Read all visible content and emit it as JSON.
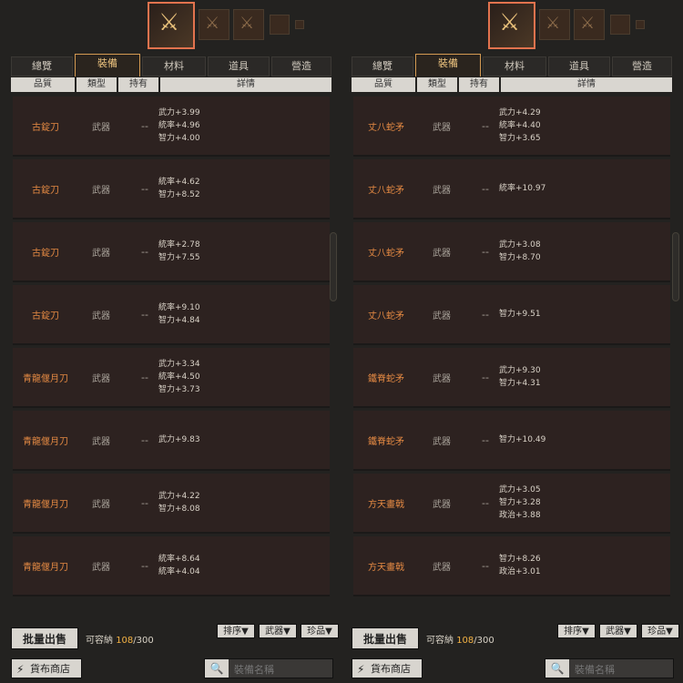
{
  "panels": [
    {
      "tabs": [
        {
          "label": "總覽",
          "active": false
        },
        {
          "label": "裝備",
          "active": true
        },
        {
          "label": "材料",
          "active": false
        },
        {
          "label": "道具",
          "active": false
        },
        {
          "label": "營造",
          "active": false
        }
      ],
      "columns": [
        "品質",
        "類型",
        "持有",
        "詳情"
      ],
      "rows": [
        {
          "name": "古錠刀",
          "type": "武器",
          "owned": "--",
          "details": [
            "武力+3.99",
            "統率+4.96",
            "智力+4.00"
          ]
        },
        {
          "name": "古錠刀",
          "type": "武器",
          "owned": "--",
          "details": [
            "統率+4.62",
            "智力+8.52"
          ]
        },
        {
          "name": "古錠刀",
          "type": "武器",
          "owned": "--",
          "details": [
            "統率+2.78",
            "智力+7.55"
          ]
        },
        {
          "name": "古錠刀",
          "type": "武器",
          "owned": "--",
          "details": [
            "統率+9.10",
            "智力+4.84"
          ]
        },
        {
          "name": "青龍偃月刀",
          "type": "武器",
          "owned": "--",
          "details": [
            "武力+3.34",
            "統率+4.50",
            "智力+3.73"
          ]
        },
        {
          "name": "青龍偃月刀",
          "type": "武器",
          "owned": "--",
          "details": [
            "武力+9.83"
          ]
        },
        {
          "name": "青龍偃月刀",
          "type": "武器",
          "owned": "--",
          "details": [
            "武力+4.22",
            "智力+8.08"
          ]
        },
        {
          "name": "青龍偃月刀",
          "type": "武器",
          "owned": "--",
          "details": [
            "統率+8.64",
            "統率+4.04"
          ]
        }
      ],
      "sell_label": "批量出售",
      "capacity_label": "可容納",
      "capacity_used": "108",
      "capacity_total": "/300",
      "filters": [
        "排序▼",
        "武器▼",
        "珍品▼"
      ],
      "shop_label": "貨布商店",
      "search_placeholder": "裝備名稱"
    },
    {
      "tabs": [
        {
          "label": "總覽",
          "active": false
        },
        {
          "label": "裝備",
          "active": true
        },
        {
          "label": "材料",
          "active": false
        },
        {
          "label": "道具",
          "active": false
        },
        {
          "label": "營造",
          "active": false
        }
      ],
      "columns": [
        "品質",
        "類型",
        "持有",
        "詳情"
      ],
      "rows": [
        {
          "name": "丈八蛇矛",
          "type": "武器",
          "owned": "--",
          "details": [
            "武力+4.29",
            "統率+4.40",
            "智力+3.65"
          ]
        },
        {
          "name": "丈八蛇矛",
          "type": "武器",
          "owned": "--",
          "details": [
            "統率+10.97"
          ]
        },
        {
          "name": "丈八蛇矛",
          "type": "武器",
          "owned": "--",
          "details": [
            "武力+3.08",
            "智力+8.70"
          ]
        },
        {
          "name": "丈八蛇矛",
          "type": "武器",
          "owned": "--",
          "details": [
            "智力+9.51"
          ]
        },
        {
          "name": "鐵脊蛇矛",
          "type": "武器",
          "owned": "--",
          "details": [
            "武力+9.30",
            "智力+4.31"
          ]
        },
        {
          "name": "鐵脊蛇矛",
          "type": "武器",
          "owned": "--",
          "details": [
            "智力+10.49"
          ]
        },
        {
          "name": "方天畫戟",
          "type": "武器",
          "owned": "--",
          "details": [
            "武力+3.05",
            "智力+3.28",
            "政治+3.88"
          ]
        },
        {
          "name": "方天畫戟",
          "type": "武器",
          "owned": "--",
          "details": [
            "智力+8.26",
            "政治+3.01"
          ]
        }
      ],
      "sell_label": "批量出售",
      "capacity_label": "可容納",
      "capacity_used": "108",
      "capacity_total": "/300",
      "filters": [
        "排序▼",
        "武器▼",
        "珍品▼"
      ],
      "shop_label": "貨布商店",
      "search_placeholder": "裝備名稱"
    }
  ],
  "icons": {
    "selected_item": "halberd-icon",
    "shop": "spear-icon",
    "search": "search-icon"
  },
  "colors": {
    "accent_border": "#e2734e",
    "tab_active": "#f0c680",
    "item_name": "#e58a43",
    "capacity_used": "#f3b244"
  }
}
